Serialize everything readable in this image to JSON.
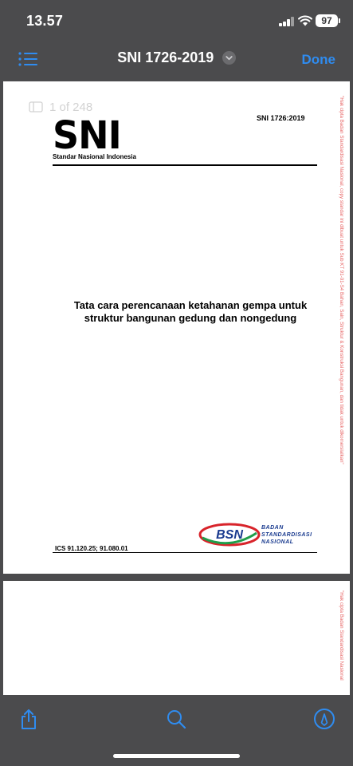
{
  "status_bar": {
    "time": "13.57",
    "battery": "97"
  },
  "nav": {
    "title": "SNI 1726-2019",
    "done_label": "Done",
    "accent_color": "#2f8cf0"
  },
  "viewer": {
    "page_counter": "1 of 248"
  },
  "document": {
    "logo": "SNI",
    "logo_subtitle": "Standar Nasional Indonesia",
    "number": "SNI 1726:2019",
    "title_line1": "Tata cara perencanaan ketahanan gempa untuk",
    "title_line2": "struktur bangunan gedung dan nongedung",
    "ics": "ICS 91.120.25;  91.080.01",
    "publisher_line1": "BADAN",
    "publisher_line2": "STANDARDISASI",
    "publisher_line3": "NASIONAL",
    "publisher_logo": "BSN",
    "watermark": "\"Hak cipta Badan Standardisasi Nasional, copy standar ini dibuat untuk Sub KT 91-01-S4 Bahan, Sain, Struktur & Konstruksi Bangunan, dan tidak untuk dikomersialkan\"",
    "watermark_page2": "\"Hak cipta Badan Standardisasi Nasional"
  },
  "toolbar": {
    "icons": [
      "share-icon",
      "search-icon",
      "markup-icon"
    ]
  }
}
